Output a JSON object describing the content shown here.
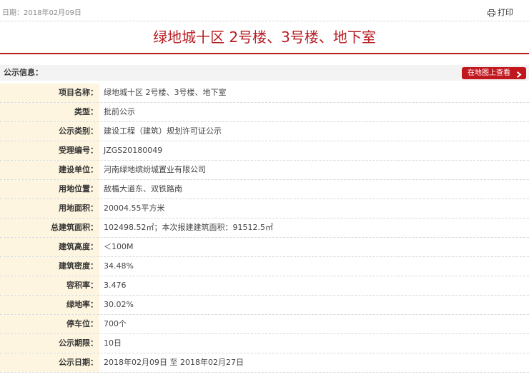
{
  "header": {
    "date_text": "日期：2018年02月09日",
    "print_label": "打印",
    "title": "绿地城十区 2号楼、3号楼、地下室"
  },
  "section": {
    "label": "公示信息：",
    "map_button": "在地图上查看"
  },
  "rows": [
    {
      "key": "项目名称：",
      "value": "绿地城十区 2号楼、3号楼、地下室"
    },
    {
      "key": "类型：",
      "value": "批前公示"
    },
    {
      "key": "公示类别：",
      "value": "建设工程（建筑）规划许可证公示"
    },
    {
      "key": "受理编号：",
      "value": "JZGS20180049"
    },
    {
      "key": "建设单位：",
      "value": "河南绿地缤纷城置业有限公司"
    },
    {
      "key": "用地位置：",
      "value": "敌楯大道东、双铁路南"
    },
    {
      "key": "用地面积：",
      "value": "20004.55平方米"
    },
    {
      "key": "总建筑面积：",
      "value": "102498.52㎡；本次报建建筑面积：91512.5㎡"
    },
    {
      "key": "建筑高度：",
      "value": "＜100M"
    },
    {
      "key": "建筑密度：",
      "value": "34.48%"
    },
    {
      "key": "容积率：",
      "value": "3.476"
    },
    {
      "key": "绿地率：",
      "value": "30.02%"
    },
    {
      "key": "停车位：",
      "value": "700个"
    },
    {
      "key": "公示期限：",
      "value": "10日"
    },
    {
      "key": "公示日期：",
      "value": "2018年02月09日 至 2018年02月27日"
    }
  ],
  "colors": {
    "accent_red": "#b81c22",
    "label_bg": "#fdf5df"
  }
}
